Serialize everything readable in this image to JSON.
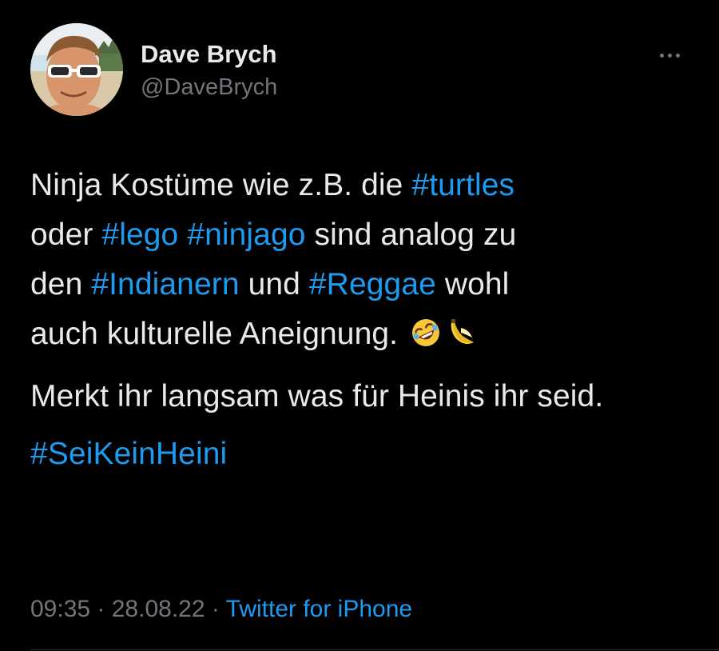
{
  "author": {
    "name": "Dave Brych",
    "handle": "@DaveBrych",
    "avatar_icon": "profile-photo"
  },
  "more_icon": "more-dots-icon",
  "tweet": {
    "line1_a": "Ninja Kostüme wie z.B. die ",
    "tag_turtles": "#turtles",
    "line2_a": "oder ",
    "tag_lego": "#lego",
    "space1": " ",
    "tag_ninjago": "#ninjago",
    "line2_b": " sind analog zu",
    "line3_a": "den ",
    "tag_indianern": "#Indianern",
    "line3_b": " und ",
    "tag_reggae": "#Reggae",
    "line3_c": " wohl",
    "line4_a": "auch kulturelle Aneignung.",
    "emojis": [
      "rolling-on-floor-laughing-emoji",
      "banana-emoji"
    ],
    "paragraph2": "Merkt ihr langsam was für Heinis ihr seid.",
    "tag_final": "#SeiKeinHeini"
  },
  "meta": {
    "time": "09:35",
    "separator1": " · ",
    "date": "28.08.22",
    "separator2": " · ",
    "source": "Twitter for iPhone"
  },
  "colors": {
    "background": "#000000",
    "text": "#e7e9ea",
    "secondary": "#71767b",
    "accent": "#1d9bf0"
  }
}
